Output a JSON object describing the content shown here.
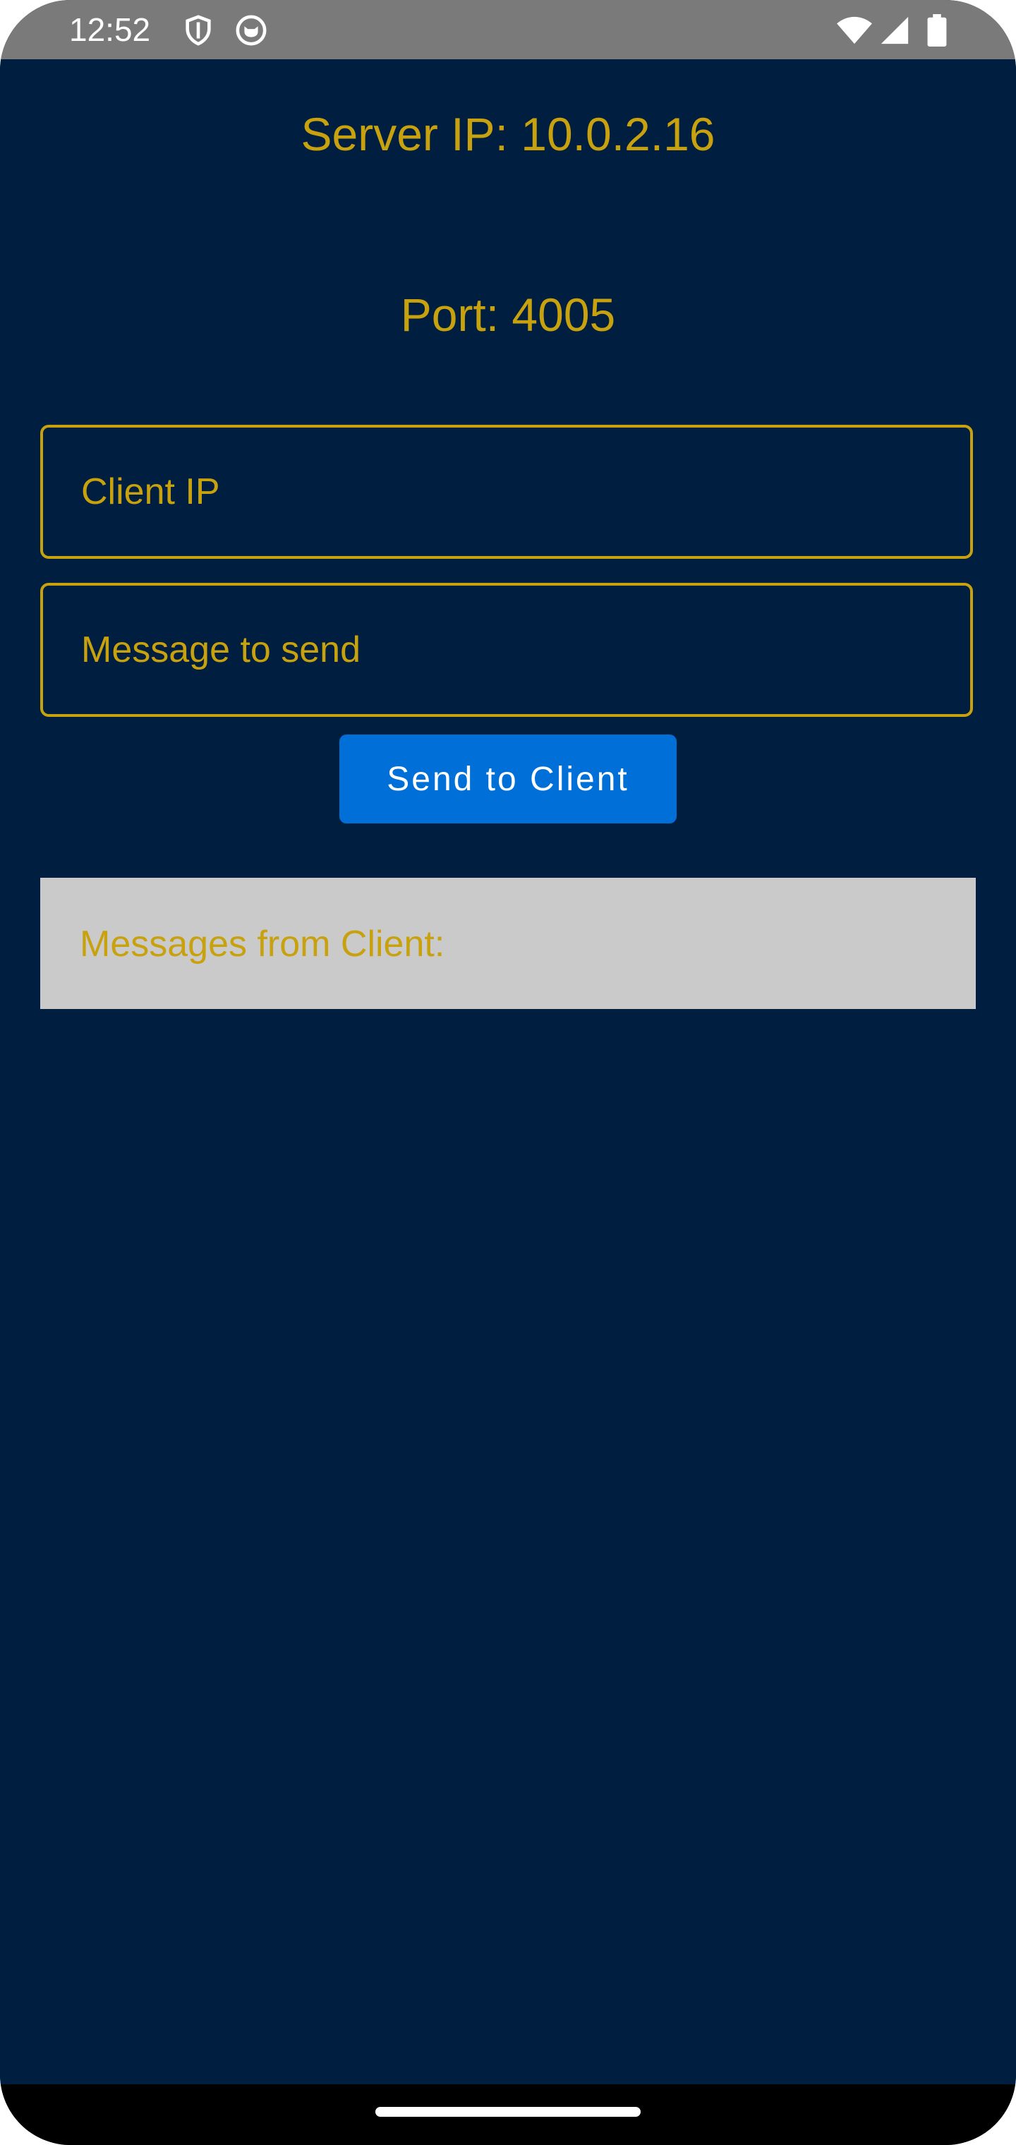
{
  "status_bar": {
    "time": "12:52",
    "left_icons": [
      "shield-icon",
      "cat-face-icon"
    ],
    "right_icons": [
      "wifi-icon",
      "cell-signal-icon",
      "battery-icon"
    ]
  },
  "server": {
    "ip_text": "Server IP: 10.0.2.16",
    "port_text": "Port: 4005"
  },
  "form": {
    "client_ip": {
      "value": "",
      "placeholder": "Client IP"
    },
    "message": {
      "value": "",
      "placeholder": "Message to send"
    },
    "send_label": "Send to Client"
  },
  "messages": {
    "label": "Messages from Client:"
  },
  "colors": {
    "background": "#001f40",
    "accent_gold": "#c8a10e",
    "button_blue": "#0070d8",
    "panel_gray": "#cbcacb",
    "status_bar": "#7a7a7a"
  }
}
